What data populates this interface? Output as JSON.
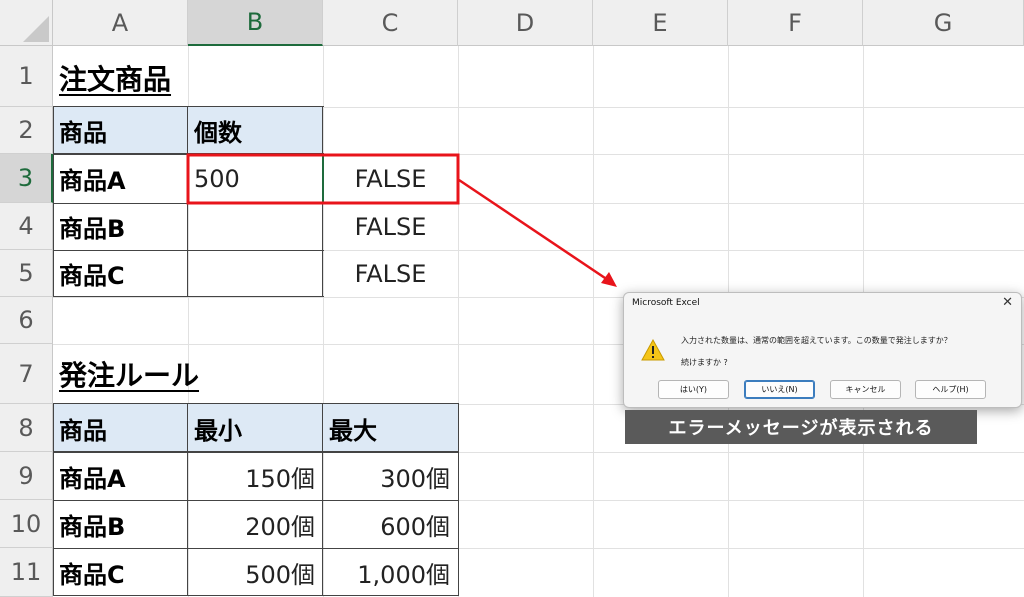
{
  "columns": [
    "A",
    "B",
    "C",
    "D",
    "E",
    "F",
    "G"
  ],
  "rows": [
    "1",
    "2",
    "3",
    "4",
    "5",
    "6",
    "7",
    "8",
    "9",
    "10",
    "11"
  ],
  "selected_cell": "B3",
  "order_section": {
    "title": "注文商品",
    "header": [
      "商品",
      "個数"
    ],
    "rows": [
      {
        "product": "商品A",
        "qty": "500",
        "check": "FALSE"
      },
      {
        "product": "商品B",
        "qty": "",
        "check": "FALSE"
      },
      {
        "product": "商品C",
        "qty": "",
        "check": "FALSE"
      }
    ]
  },
  "rule_section": {
    "title": "発注ルール",
    "header": [
      "商品",
      "最小",
      "最大"
    ],
    "rows": [
      {
        "product": "商品A",
        "min": "150個",
        "max": "300個"
      },
      {
        "product": "商品B",
        "min": "200個",
        "max": "600個"
      },
      {
        "product": "商品C",
        "min": "500個",
        "max": "1,000個"
      }
    ]
  },
  "dialog": {
    "title": "Microsoft Excel",
    "close": "✕",
    "message_line1": "入力された数量は、通常の範囲を超えています。この数量で発注しますか？",
    "message_line2": "続けますか ?",
    "icon": "warning-icon",
    "buttons": [
      "はい(Y)",
      "いいえ(N)",
      "キャンセル",
      "ヘルプ(H)"
    ]
  },
  "caption": "エラーメッセージが表示される",
  "colors": {
    "highlight_red": "#e8141b",
    "header_fill": "#dde9f5",
    "selected_header": "#1e6b3c",
    "caption_bg": "#5a5a5a",
    "warning_yellow": "#f5c518"
  }
}
